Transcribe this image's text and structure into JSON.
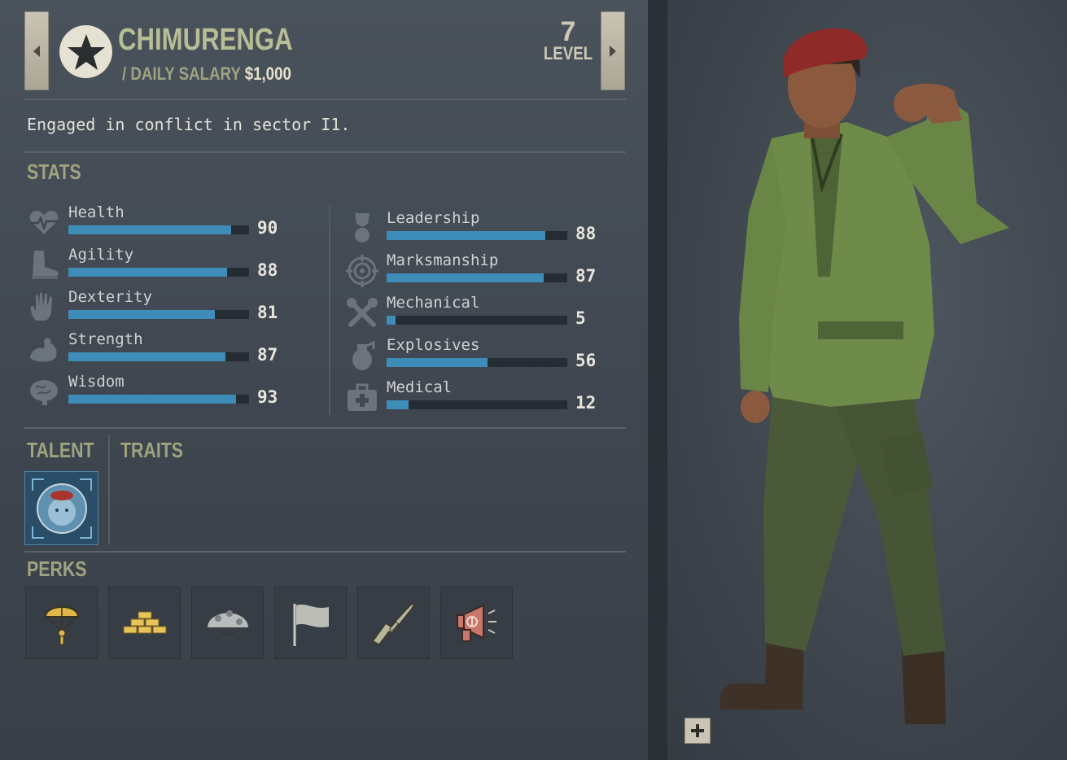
{
  "merc": {
    "name": "CHIMURENGA",
    "salary_label": "/ DAILY SALARY",
    "salary_value": "$1,000",
    "level_number": "7",
    "level_label": "LEVEL",
    "status": "Engaged in conflict in sector I1.",
    "icon": "star-icon"
  },
  "sections": {
    "stats": "STATS",
    "talent": "TALENT",
    "traits": "TRAITS",
    "perks": "PERKS"
  },
  "stats_left": [
    {
      "label": "Health",
      "value": 90,
      "icon": "heart-icon"
    },
    {
      "label": "Agility",
      "value": 88,
      "icon": "boot-icon"
    },
    {
      "label": "Dexterity",
      "value": 81,
      "icon": "hand-icon"
    },
    {
      "label": "Strength",
      "value": 87,
      "icon": "bicep-icon"
    },
    {
      "label": "Wisdom",
      "value": 93,
      "icon": "brain-icon"
    }
  ],
  "stats_right": [
    {
      "label": "Leadership",
      "value": 88,
      "icon": "medal-icon"
    },
    {
      "label": "Marksmanship",
      "value": 87,
      "icon": "crosshair-icon"
    },
    {
      "label": "Mechanical",
      "value": 5,
      "icon": "wrench-icon"
    },
    {
      "label": "Explosives",
      "value": 56,
      "icon": "grenade-icon"
    },
    {
      "label": "Medical",
      "value": 12,
      "icon": "medkit-icon"
    }
  ],
  "talent": {
    "icon": "lion-talent-icon"
  },
  "perks": [
    {
      "icon": "parachute-icon"
    },
    {
      "icon": "gold-bars-icon"
    },
    {
      "icon": "helmet-icon"
    },
    {
      "icon": "white-flag-icon"
    },
    {
      "icon": "rifle-icon"
    },
    {
      "icon": "megaphone-icon"
    }
  ],
  "colors": {
    "accent_olive": "#9fa37f",
    "bar_fill": "#3d8db8",
    "talent_bg": "#2a4e68"
  }
}
